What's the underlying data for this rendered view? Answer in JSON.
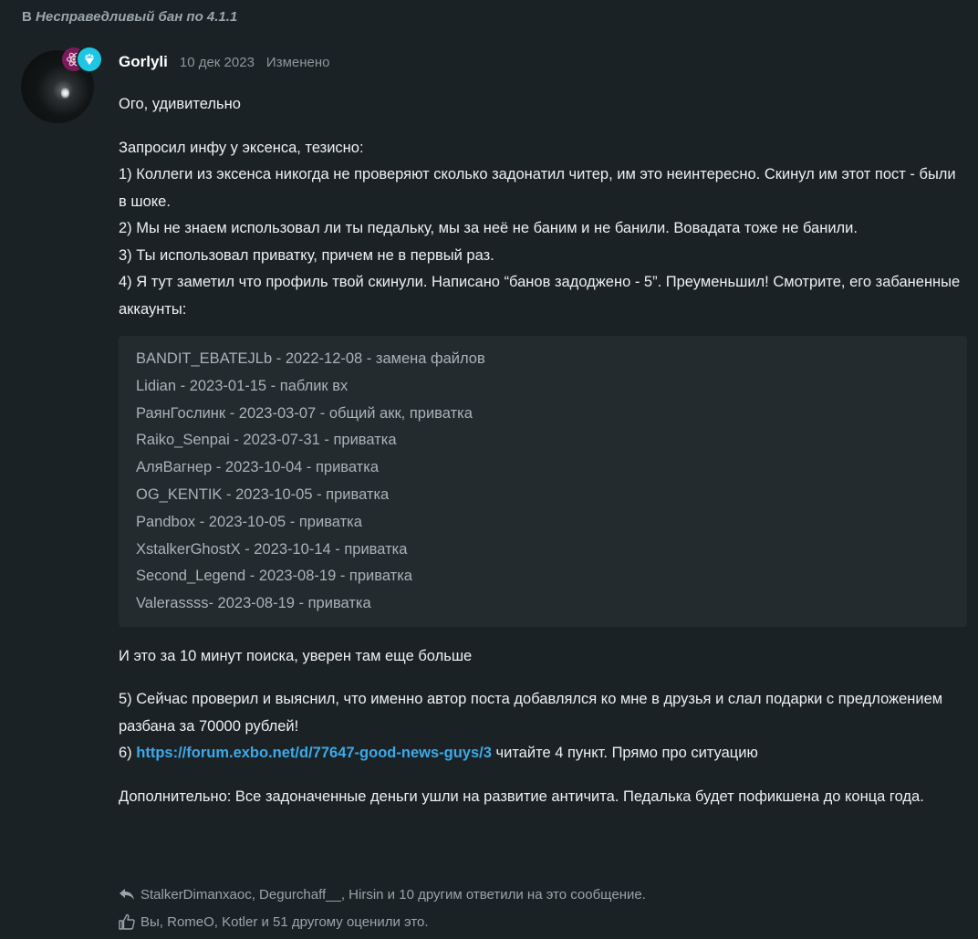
{
  "context": {
    "prefix": "В",
    "thread_title": "Несправедливый бан по 4.1.1"
  },
  "post": {
    "author": "Gorlyli",
    "date": "10 дек 2023",
    "edited_label": "Изменено",
    "greeting": "Ого, удивительно",
    "intro": "Запросил инфу у эксенса, тезисно:",
    "points": [
      "1) Коллеги из эксенса никогда не проверяют сколько задонатил читер, им это неинтересно. Скинул им этот пост - были в шоке.",
      "2) Мы не знаем использовал ли ты педальку, мы за неё не баним и не банили. Вовадата тоже не банили.",
      "3) Ты использовал приватку, причем не в первый раз.",
      "4) Я тут заметил что профиль твой скинули. Написано “банов задоджено - 5”. Преуменьшил! Смотрите, его забаненные аккаунты:"
    ],
    "banned_accounts": [
      "BANDIT_EBATEJLb - 2022-12-08 - замена файлов",
      "Lidian - 2023-01-15 - паблик вх",
      "РаянГослинк - 2023-03-07 - общий акк, приватка",
      "Raiko_Senpai - 2023-07-31 - приватка",
      "АляВагнер - 2023-10-04 - приватка",
      "OG_KENTIK - 2023-10-05 - приватка",
      "Pandbox - 2023-10-05 - приватка",
      "XstalkerGhostX - 2023-10-14 - приватка",
      "Second_Legend - 2023-08-19 - приватка",
      "Valerassss- 2023-08-19 - приватка"
    ],
    "after_list": "И это за 10 минут поиска, уверен там еще больше",
    "point5": "5) Сейчас проверил и выяснил, что именно автор поста добавлялся ко мне в друзья и слал подарки с предложением разбана за 70000 рублей!",
    "point6_prefix": "6)",
    "point6_link": "https://forum.exbo.net/d/77647-good-news-guys/3",
    "point6_suffix": "читайте 4 пункт. Прямо про ситуацию",
    "additional": "Дополнительно: Все задоначенные деньги ушли на развитие античита. Педалька будет пофикшена до конца года."
  },
  "footer": {
    "replies_text": "StalkerDimanxaoc, Degurchaff__, Hirsin и 10 другим ответили на это сообщение.",
    "likes_text": "Вы, RomeO, Kotler и 51 другому оценили это."
  },
  "colors": {
    "background": "#1b2225",
    "code_block": "#232b2e",
    "link": "#3da9e9",
    "badge_atom": "#7b1a5a",
    "badge_diamond": "#1fc6e4"
  }
}
